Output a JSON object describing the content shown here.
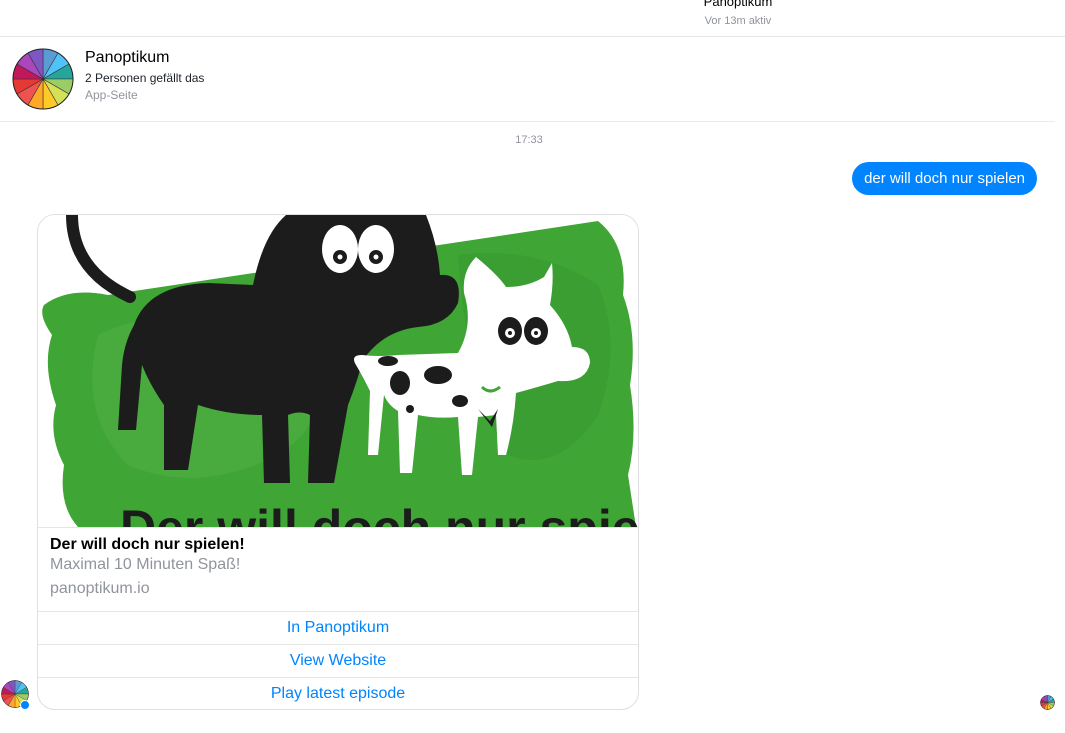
{
  "topbar": {
    "name": "Panoptikum",
    "status": "Vor 13m aktiv"
  },
  "page": {
    "title": "Panoptikum",
    "likes": "2 Personen gefällt das",
    "category": "App-Seite"
  },
  "thread": {
    "timestamp": "17:33",
    "outgoing_message": "der will doch nur spielen",
    "outgoing_color": "#0084ff"
  },
  "card": {
    "image_caption": "Der will doch nur spielen!",
    "title": "Der will doch nur spielen!",
    "subtitle": "Maximal 10 Minuten Spaß!",
    "domain": "panoptikum.io",
    "buttons": [
      "In Panoptikum",
      "View Website",
      "Play latest episode"
    ],
    "accent_color": "#3fa535"
  },
  "icons": {
    "page_avatar": "color-wheel-avatar",
    "badge": "messenger-badge-icon",
    "seen": "seen-avatar"
  }
}
